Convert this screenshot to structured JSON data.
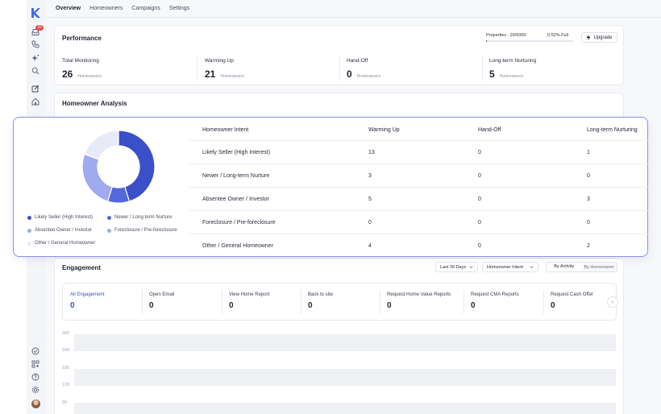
{
  "sidebar": {
    "logo": "kleerly-logo",
    "items": [
      {
        "icon": "inbox-icon",
        "badge": "33"
      },
      {
        "icon": "phone-icon"
      },
      {
        "icon": "sparkles-icon"
      },
      {
        "icon": "search-icon"
      },
      {
        "icon": "edit-icon"
      },
      {
        "icon": "home-icon"
      },
      {
        "icon": "check-circle-icon"
      },
      {
        "icon": "grid-icon"
      },
      {
        "icon": "help-icon"
      },
      {
        "icon": "settings-icon"
      }
    ]
  },
  "tabs": [
    {
      "label": "Overview",
      "active": true
    },
    {
      "label": "Homeowners",
      "active": false
    },
    {
      "label": "Campaigns",
      "active": false
    },
    {
      "label": "Settings",
      "active": false
    }
  ],
  "performance": {
    "title": "Performance",
    "properties_label": "Properties : 26/5000",
    "properties_pct": "0.52% Full",
    "properties_fraction": 0.0052,
    "upgrade_label": "Upgrade",
    "stats": [
      {
        "label": "Total Monitoring",
        "value": "26",
        "sub": "Homeowners"
      },
      {
        "label": "Warming Up",
        "value": "21",
        "sub": "Homeowners"
      },
      {
        "label": "Hand-Off",
        "value": "0",
        "sub": "Homeowners"
      },
      {
        "label": "Long-term Nurturing",
        "value": "5",
        "sub": "Homeowners"
      }
    ]
  },
  "analysis": {
    "title": "Homeowner Analysis",
    "colors": [
      "#3b4fc8",
      "#5268db",
      "#a0aaee",
      "#e8eaf7"
    ],
    "legend": [
      "Likely Seller (High Interest)",
      "Newer / Long-term Nurture",
      "Absentee Owner / Investor",
      "Foreclosure / Pre-foreclosure",
      "Other / General Homeowner"
    ],
    "table": {
      "headers": [
        "Homeowner Intent",
        "Warming Up",
        "Hand-Off",
        "Long-term Nurturing"
      ],
      "rows": [
        [
          "Likely Seller (High Interest)",
          "13",
          "0",
          "1"
        ],
        [
          "Newer / Long-term Nurture",
          "3",
          "0",
          "0"
        ],
        [
          "Absentee Owner / Investor",
          "5",
          "0",
          "3"
        ],
        [
          "Foreclosure / Pre-foreclosure",
          "0",
          "0",
          "0"
        ],
        [
          "Other / General Homeowner",
          "4",
          "0",
          "2"
        ]
      ]
    }
  },
  "chart_data": {
    "type": "pie",
    "categories": [
      "Likely Seller (High Interest)",
      "Newer / Long-term Nurture",
      "Absentee Owner / Investor",
      "Foreclosure / Pre-foreclosure",
      "Other / General Homeowner"
    ],
    "values": [
      14,
      3,
      8,
      0,
      6
    ],
    "donut": true
  },
  "engagement": {
    "title": "Engagement",
    "range_label": "Last 30 Days",
    "intent_label": "Homeowner Intent",
    "segment": [
      "By Activity",
      "By Homeowner"
    ],
    "metrics": [
      {
        "label": "All Engagement",
        "value": "0"
      },
      {
        "label": "Open Email",
        "value": "0"
      },
      {
        "label": "View Home Report",
        "value": "0"
      },
      {
        "label": "Back to site",
        "value": "0"
      },
      {
        "label": "Request Home Value Reports",
        "value": "0"
      },
      {
        "label": "Request CMA Reports",
        "value": "0"
      },
      {
        "label": "Request Cash Offer",
        "value": "0"
      }
    ],
    "y_ticks": [
      "300",
      "240",
      "180",
      "120",
      "60"
    ]
  }
}
